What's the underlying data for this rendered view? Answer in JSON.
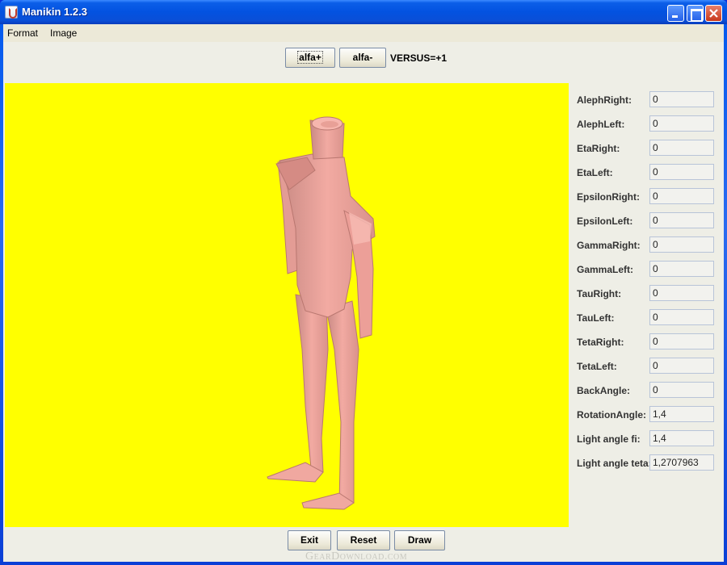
{
  "window": {
    "title": "Manikin 1.2.3"
  },
  "menu": {
    "items": [
      "Format",
      "Image"
    ]
  },
  "toolbar": {
    "alfa_plus": "alfa+",
    "alfa_minus": "alfa-",
    "versus": "VERSUS=+1"
  },
  "canvas": {
    "background": "#ffff00",
    "figure_color": "#f0a8a0"
  },
  "params": [
    {
      "label": "AlephRight:",
      "value": "0"
    },
    {
      "label": "AlephLeft:",
      "value": "0"
    },
    {
      "label": "EtaRight:",
      "value": "0"
    },
    {
      "label": "EtaLeft:",
      "value": "0"
    },
    {
      "label": "EpsilonRight:",
      "value": "0"
    },
    {
      "label": "EpsilonLeft:",
      "value": "0"
    },
    {
      "label": "GammaRight:",
      "value": "0"
    },
    {
      "label": "GammaLeft:",
      "value": "0"
    },
    {
      "label": "TauRight:",
      "value": "0"
    },
    {
      "label": "TauLeft:",
      "value": "0"
    },
    {
      "label": "TetaRight:",
      "value": "0"
    },
    {
      "label": "TetaLeft:",
      "value": "0"
    },
    {
      "label": "BackAngle:",
      "value": "0"
    },
    {
      "label": "RotationAngle:",
      "value": "1,4"
    },
    {
      "label": "Light angle fi:",
      "value": "1,4"
    },
    {
      "label": "Light angle teta:",
      "value": "1,2707963"
    }
  ],
  "actions": {
    "exit": "Exit",
    "reset": "Reset",
    "draw": "Draw"
  },
  "watermark": "GearDownload.com"
}
